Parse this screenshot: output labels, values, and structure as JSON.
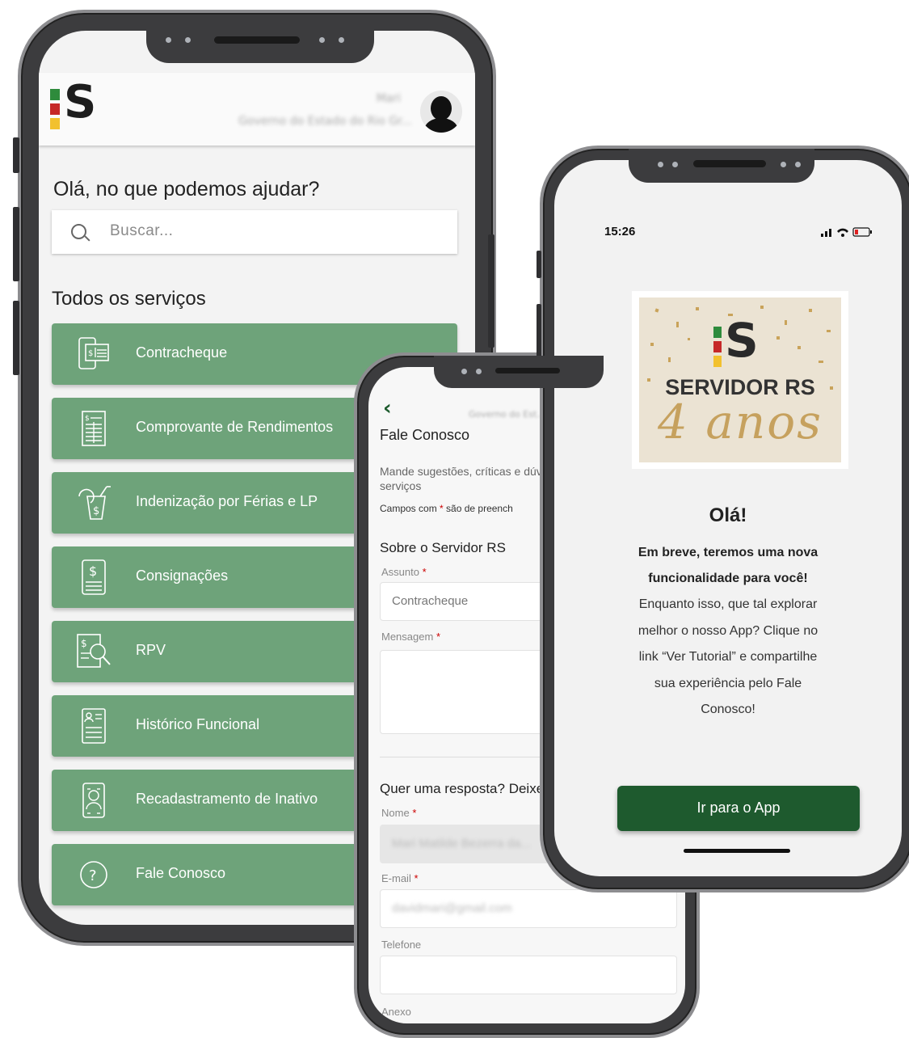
{
  "phone1": {
    "user": {
      "name": "Mari",
      "org": "Governo do Estado do Rio Gr..."
    },
    "greeting": "Olá, no que podemos ajudar?",
    "search": {
      "placeholder": "Buscar..."
    },
    "section_title": "Todos os serviços",
    "services": [
      {
        "label": "Contracheque",
        "icon": "paycheck-icon"
      },
      {
        "label": "Comprovante de Rendimentos",
        "icon": "income-receipt-icon"
      },
      {
        "label": "Indenização por Férias e LP",
        "icon": "vacation-drink-icon"
      },
      {
        "label": "Consignações",
        "icon": "money-document-icon"
      },
      {
        "label": "RPV",
        "icon": "search-document-icon"
      },
      {
        "label": "Histórico Funcional",
        "icon": "employee-record-icon"
      },
      {
        "label": "Recadastramento de Inativo",
        "icon": "mobile-user-icon"
      },
      {
        "label": "Fale Conosco",
        "icon": "help-circle-icon"
      }
    ],
    "colors": {
      "service_bg": "#6ea37a",
      "logo_green": "#2e8b3c",
      "logo_red": "#c62828",
      "logo_yellow": "#f2c12e"
    }
  },
  "phone2": {
    "back": "‹",
    "org": "Governo do Est...",
    "title": "Fale Conosco",
    "description": "Mande sugestões, críticas e dúvidas das informações ou serviços",
    "required_note_prefix": "Campos com ",
    "required_note_star": "*",
    "required_note_suffix": " são de preench",
    "section_about": "Sobre o Servidor RS",
    "subject_label": "Assunto",
    "subject_value": "Contracheque",
    "message_label": "Mensagem",
    "section_reply": "Quer uma resposta? Deixe",
    "name_label": "Nome",
    "name_value": "Mari Matilde Bezerra da...",
    "email_label": "E-mail",
    "email_value": "davidmari@gmail.com",
    "phone_label": "Telefone",
    "attachment_label": "Anexo",
    "req_star": "*"
  },
  "phone3": {
    "time": "15:26",
    "banner_title": "SERVIDOR RS",
    "banner_subtitle": "4 anos",
    "hello": "Olá!",
    "message_bold_1": "Em breve, teremos uma nova",
    "message_bold_2": "funcionalidade para você!",
    "message": [
      "Enquanto isso, que tal explorar",
      "melhor o nosso App? Clique no",
      "link “Ver Tutorial” e compartilhe",
      "sua experiência pelo Fale",
      "Conosco!"
    ],
    "button": "Ir para o App",
    "colors": {
      "button_bg": "#1e5a2e",
      "gold": "#c6a15e"
    }
  }
}
